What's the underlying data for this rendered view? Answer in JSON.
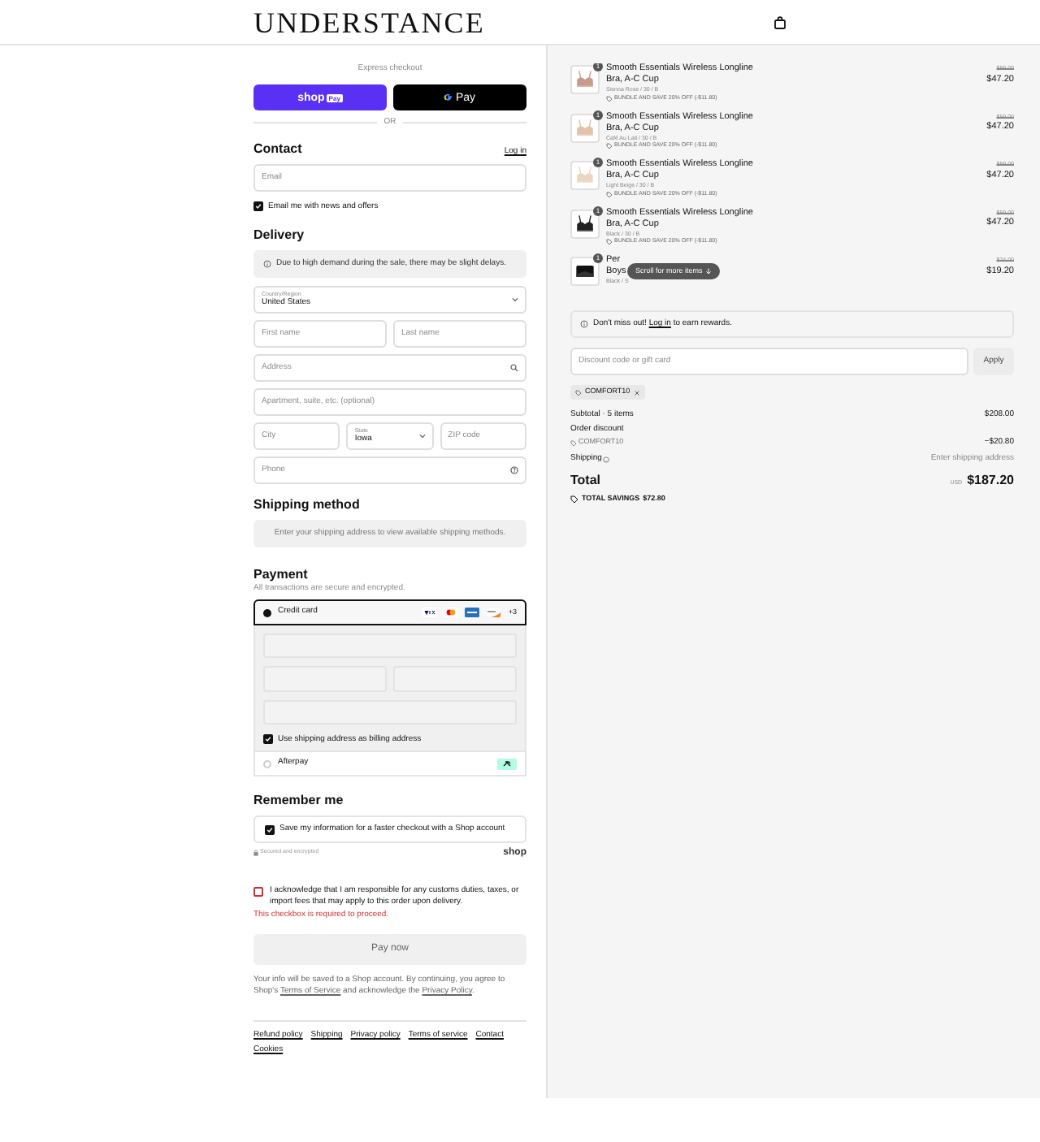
{
  "header": {
    "logo": "UNDERSTANCE"
  },
  "express_checkout": {
    "label": "Express checkout",
    "divider": "OR",
    "buttons": [
      {
        "kind": "shop_pay",
        "label": "shop",
        "badge": "Pay"
      },
      {
        "kind": "google_pay",
        "label": "Pay"
      }
    ]
  },
  "contact": {
    "heading": "Contact",
    "login_link": "Log in",
    "email": {
      "placeholder": "Email"
    },
    "news_checkbox": {
      "label": "Email me with news and offers",
      "checked": true
    }
  },
  "delivery": {
    "heading": "Delivery",
    "notice": "Due to high demand during the sale, there may be slight delays.",
    "rows": [
      [
        {
          "kind": "select",
          "label": "Country/Region",
          "value": "United States"
        }
      ],
      [
        {
          "kind": "text",
          "placeholder": "First name"
        },
        {
          "kind": "text",
          "placeholder": "Last name"
        }
      ],
      [
        {
          "kind": "address",
          "placeholder": "Address"
        }
      ],
      [
        {
          "kind": "text",
          "placeholder": "Apartment, suite, etc. (optional)"
        }
      ],
      [
        {
          "kind": "text",
          "placeholder": "City"
        },
        {
          "kind": "select",
          "label": "State",
          "value": "Iowa"
        },
        {
          "kind": "text",
          "placeholder": "ZIP code"
        }
      ],
      [
        {
          "kind": "phone",
          "placeholder": "Phone"
        }
      ]
    ]
  },
  "shipping_method": {
    "heading": "Shipping method",
    "message": "Enter your shipping address to view available shipping methods."
  },
  "payment": {
    "heading": "Payment",
    "subtitle": "All transactions are secure and encrypted.",
    "methods": [
      {
        "kind": "card",
        "label": "Credit card",
        "selected": true,
        "more_cards": "+3",
        "billing_checkbox": {
          "label": "Use shipping address as billing address",
          "checked": true
        }
      },
      {
        "kind": "afterpay",
        "label": "Afterpay",
        "selected": false
      }
    ]
  },
  "remember_me": {
    "heading": "Remember me",
    "save_checkbox": {
      "label": "Save my information for a faster checkout with a Shop account",
      "checked": true
    },
    "secured": "Secured and encrypted",
    "shop_logo": "shop"
  },
  "acknowledge": {
    "label": "I acknowledge that I am responsible for any customs duties, taxes, or import fees that may apply to this order upon delivery.",
    "checked": false,
    "error": "This checkbox is required to proceed."
  },
  "pay_button": "Pay now",
  "legal": {
    "before": "Your info will be saved to a Shop account. By continuing, you agree to Shop's ",
    "terms": "Terms of Service",
    "middle": " and acknowledge the ",
    "privacy": "Privacy Policy",
    "after": "."
  },
  "footer_links": [
    "Refund policy",
    "Shipping",
    "Privacy policy",
    "Terms of service",
    "Contact",
    "Cookies"
  ],
  "order_summary": {
    "items": [
      {
        "quantity": "1",
        "name_lines": [
          "Smooth Essentials Wireless Longline",
          "Bra, A-C Cup"
        ],
        "variant": "Sienna Rose / 30 / B",
        "offer": "BUNDLE AND SAVE 20% OFF (-$11.80)",
        "compare_price": "$59.00",
        "price": "$47.20"
      },
      {
        "quantity": "1",
        "name_lines": [
          "Smooth Essentials Wireless Longline",
          "Bra, A-C Cup"
        ],
        "variant": "Café Au Lait / 30 / B",
        "offer": "BUNDLE AND SAVE 20% OFF (-$11.80)",
        "compare_price": "$59.00",
        "price": "$47.20"
      },
      {
        "quantity": "1",
        "name_lines": [
          "Smooth Essentials Wireless Longline",
          "Bra, A-C Cup"
        ],
        "variant": "Light Beige / 30 / B",
        "offer": "BUNDLE AND SAVE 20% OFF (-$11.80)",
        "compare_price": "$59.00",
        "price": "$47.20"
      },
      {
        "quantity": "1",
        "name_lines": [
          "Smooth Essentials Wireless Longline",
          "Bra, A-C Cup"
        ],
        "variant": "Black / 30 / B",
        "offer": "BUNDLE AND SAVE 20% OFF (-$11.80)",
        "compare_price": "$59.00",
        "price": "$47.20"
      },
      {
        "quantity": "1",
        "name_lines": [
          "Per",
          "Boys"
        ],
        "variant": "Black / S",
        "compare_price": "$24.00",
        "price": "$19.20"
      }
    ],
    "scroll_hint": "Scroll for more items",
    "rewards": {
      "before": "Don't miss out! ",
      "link": "Log in",
      "after": " to earn rewards."
    },
    "discount": {
      "placeholder": "Discount code or gift card",
      "button": "Apply"
    },
    "applied_code": "COMFORT10",
    "subtotal": {
      "label": "Subtotal · 5 items",
      "value": "$208.00"
    },
    "order_discount": {
      "label": "Order discount",
      "code": "COMFORT10",
      "value": "−$20.80"
    },
    "shipping": {
      "label": "Shipping",
      "value": "Enter shipping address"
    },
    "total": {
      "label": "Total",
      "currency": "USD",
      "value": "$187.20"
    },
    "savings": {
      "label": "TOTAL SAVINGS",
      "value": "$72.80"
    }
  }
}
